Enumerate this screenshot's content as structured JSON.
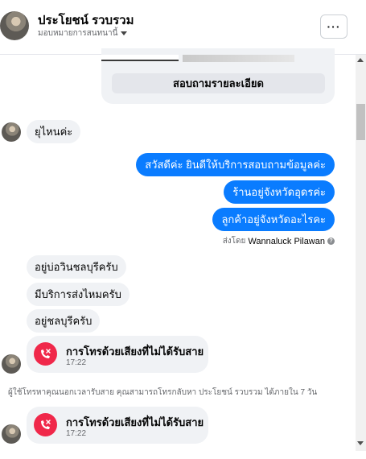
{
  "header": {
    "contact_name": "ประโยชน์ รวบรวม",
    "assign_label": "มอบหมายการสนทนานี้",
    "more_label": "···"
  },
  "card": {
    "button_label": "สอบถามรายละเอียด"
  },
  "messages": [
    {
      "direction": "in",
      "text": "ยุไหนค่ะ"
    },
    {
      "direction": "out",
      "text": "สวัสดีค่ะ ยินดีให้บริการสอบถามข้อมูลค่ะ"
    },
    {
      "direction": "out",
      "text": "ร้านอยู่จังหวัดอุดรค่ะ"
    },
    {
      "direction": "out",
      "text": "ลูกค้าอยู่จังหวัดอะไรคะ"
    },
    {
      "direction": "in",
      "text": "อยู่บ่อวินชลบุรีครับ"
    },
    {
      "direction": "in",
      "text": "มีบริการส่งไหมครับ"
    },
    {
      "direction": "in",
      "text": "อยู่ชลบุรีครับ"
    }
  ],
  "sent_by": {
    "prefix": "ส่งโดย",
    "sender": "Wannaluck Pilawan",
    "help_icon": "?"
  },
  "calls": [
    {
      "title": "การโทรด้วยเสียงที่ไม่ได้รับสาย",
      "time": "17:22"
    },
    {
      "title": "การโทรด้วยเสียงที่ไม่ได้รับสาย",
      "time": "17:22"
    }
  ],
  "system_note": "ผู้ใช้โทรหาคุณนอกเวลารับสาย คุณสามารถโทรกลับหา ประโยชน์ รวบรวม ได้ภายใน 7 วัน",
  "colors": {
    "outgoing_bubble": "#0a7cff",
    "incoming_bubble": "#f0f2f5",
    "missed_call": "#f0284a"
  },
  "icons": {
    "avatar": "contact-avatar",
    "caret": "chevron-down-icon",
    "more": "more-icon",
    "missed_call": "missed-call-icon"
  }
}
